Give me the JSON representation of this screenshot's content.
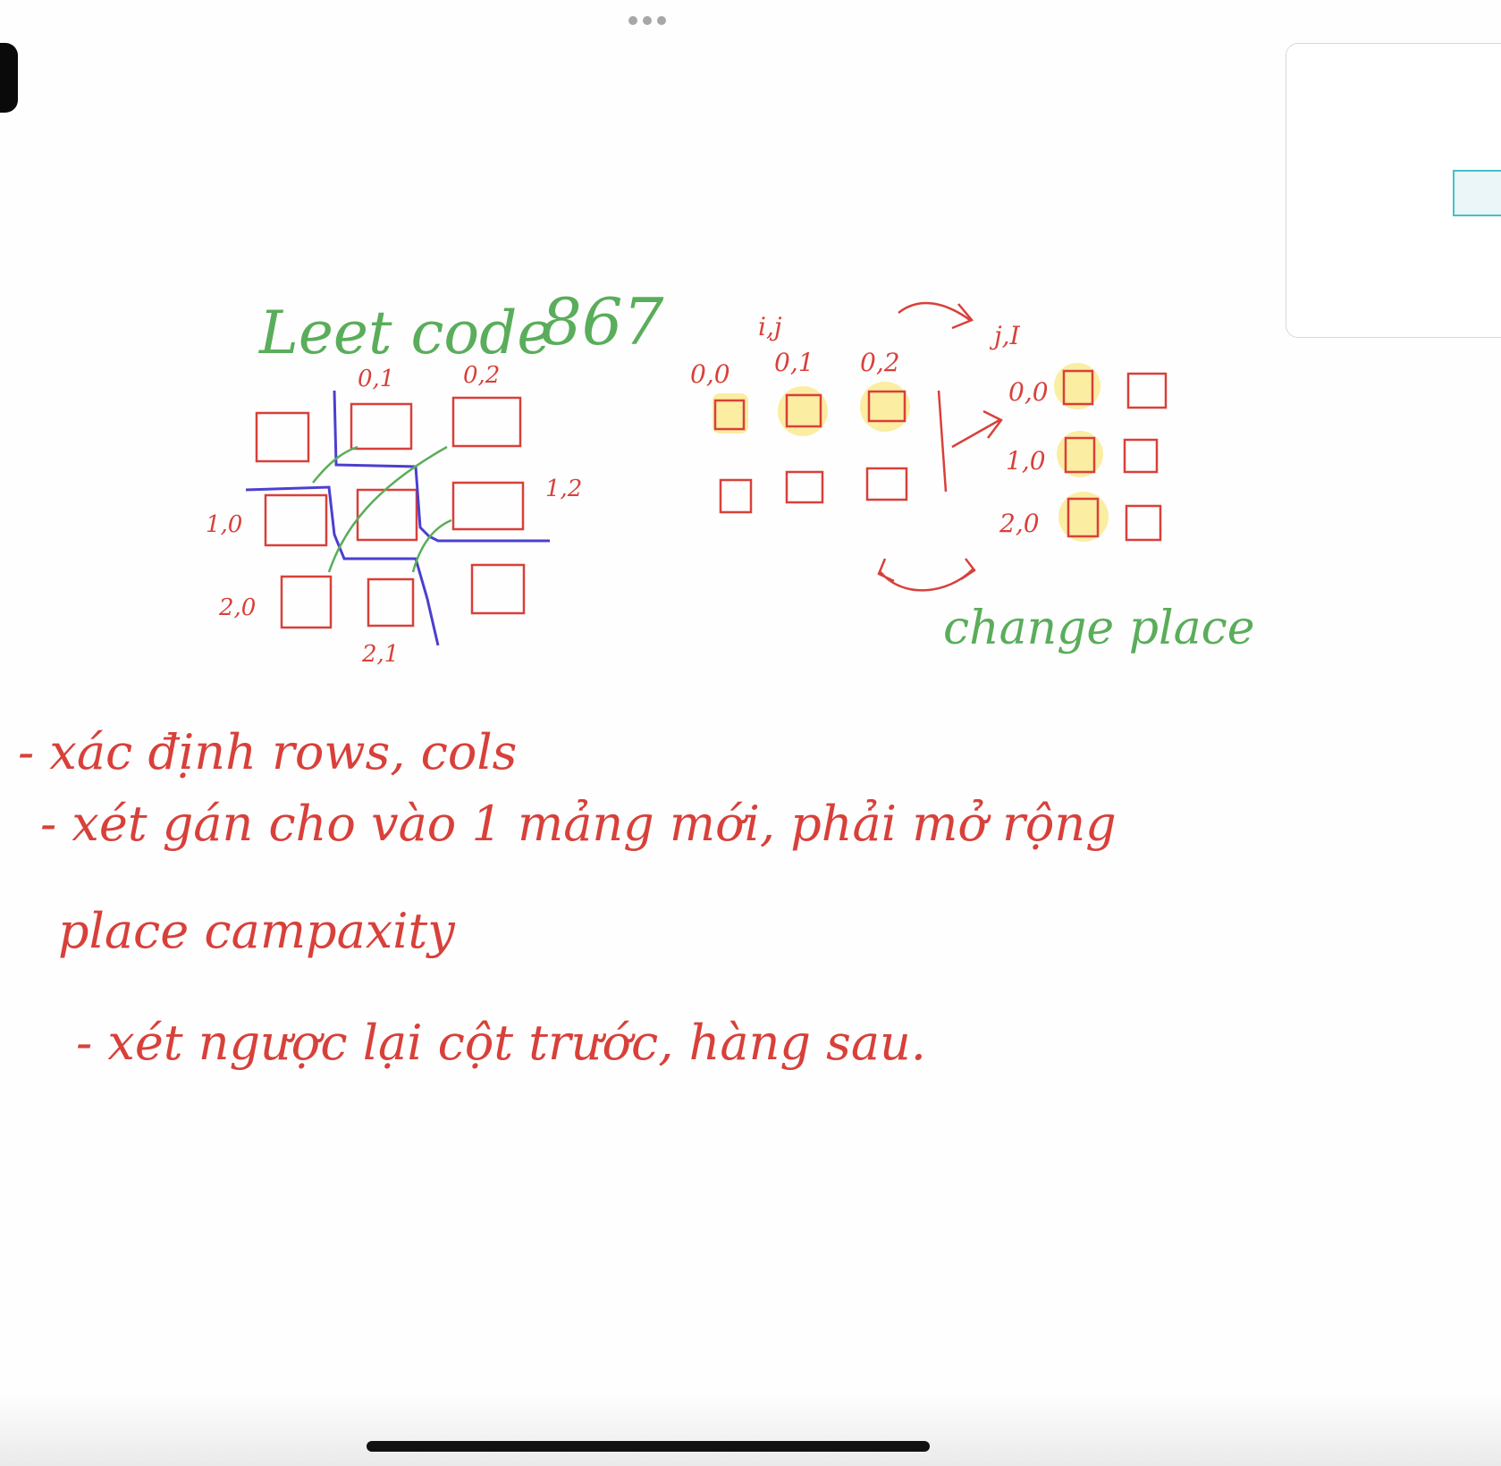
{
  "title": {
    "leetcode": "Leet code",
    "number": "867"
  },
  "left_grid_labels": {
    "c01": "0,1",
    "c02": "0,2",
    "c10": "1,0",
    "c12": "1,2",
    "c20": "2,0",
    "c21": "2,1"
  },
  "transpose_labels": {
    "ij": "i,j",
    "ji": "j,I",
    "top_row": [
      "0,0",
      "0,1",
      "0,2"
    ],
    "right_col": [
      "0,0",
      "1,0",
      "2,0"
    ],
    "change_place": "change place"
  },
  "notes": [
    "- xác định rows, cols",
    "- xét gán cho vào 1 mảng mới, phải mở rộng",
    "place campaxity",
    "- xét ngược lại cột trước, hàng sau."
  ],
  "colors": {
    "ink_red": "#d8403a",
    "ink_green": "#5aad5a",
    "ink_blue": "#4b3fd0",
    "highlight": "#fbe98a"
  }
}
